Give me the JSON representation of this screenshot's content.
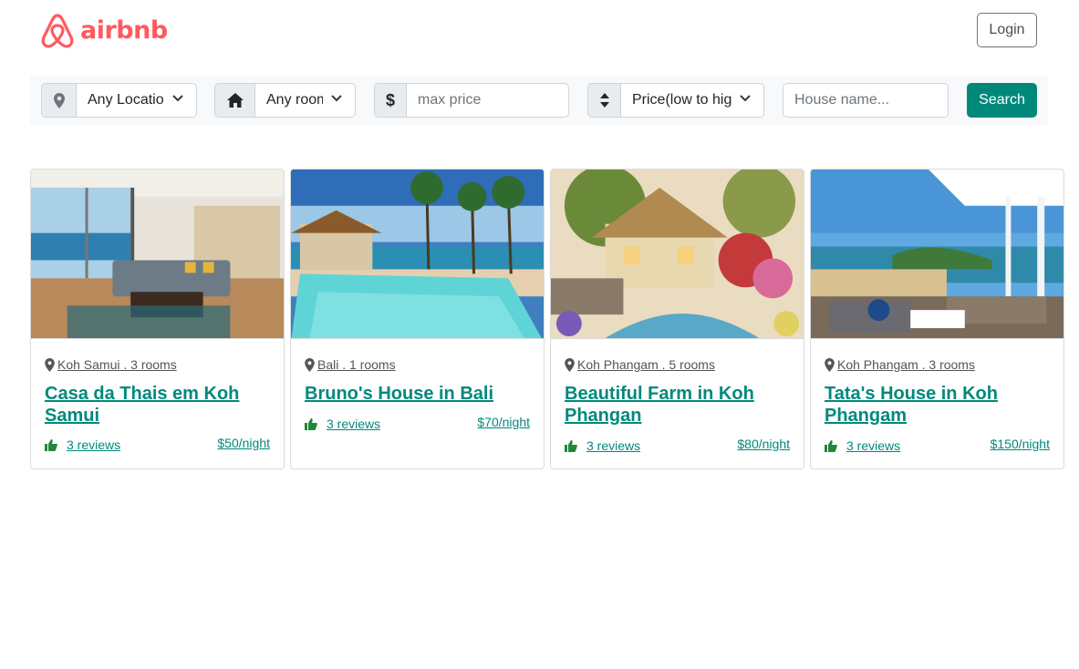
{
  "header": {
    "logo_text": "airbnb",
    "brand_color": "#ff5a5f",
    "login_label": "Login"
  },
  "filters": {
    "location": {
      "icon": "map-marker-icon",
      "selected": "Any Location"
    },
    "rooms": {
      "icon": "home-icon",
      "selected": "Any rooms"
    },
    "price": {
      "icon": "dollar-icon",
      "placeholder": "max price"
    },
    "sort": {
      "icon": "sort-icon",
      "selected": "Price(low to high)"
    },
    "house_name": {
      "placeholder": "House name..."
    },
    "search_label": "Search",
    "accent_color": "#00897b"
  },
  "listings": [
    {
      "location": "Koh Samui",
      "rooms": "3 rooms",
      "meta": "Koh Samui . 3 rooms",
      "title": "Casa da Thais em Koh Samui",
      "reviews": "3 reviews",
      "price": "$50/night",
      "image": "living-room-photo"
    },
    {
      "location": "Bali",
      "rooms": "1 rooms",
      "meta": "Bali . 1 rooms",
      "title": "Bruno's House in Bali",
      "reviews": "3 reviews",
      "price": "$70/night",
      "image": "pool-beach-photo"
    },
    {
      "location": "Koh Phangam",
      "rooms": "5 rooms",
      "meta": "Koh Phangam . 5 rooms",
      "title": "Beautiful Farm in Koh Phangan",
      "reviews": "3 reviews",
      "price": "$80/night",
      "image": "cottage-painting-photo"
    },
    {
      "location": "Koh Phangam",
      "rooms": "3 rooms",
      "meta": "Koh Phangam . 3 rooms",
      "title": "Tata's House in Koh Phangam",
      "reviews": "3 reviews",
      "price": "$150/night",
      "image": "terrace-sea-photo"
    }
  ]
}
